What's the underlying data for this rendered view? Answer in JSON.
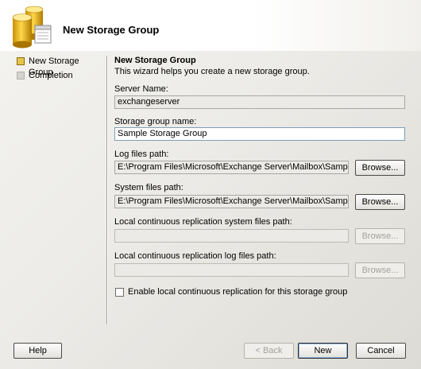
{
  "header": {
    "title": "New Storage Group",
    "icon": "storage-group-icon"
  },
  "nav": {
    "items": [
      {
        "label": "New Storage Group",
        "state": "active"
      },
      {
        "label": "Completion",
        "state": "inactive"
      }
    ]
  },
  "main": {
    "title": "New Storage Group",
    "description": "This wizard helps you create a new storage group.",
    "server_name": {
      "label": "Server Name:",
      "value": "exchangeserver"
    },
    "storage_group_name": {
      "label": "Storage group name:",
      "value": "Sample Storage Group"
    },
    "log_files_path": {
      "label": "Log files path:",
      "value": "E:\\Program Files\\Microsoft\\Exchange Server\\Mailbox\\Sample Storage G",
      "browse_label": "Browse..."
    },
    "system_files_path": {
      "label": "System files path:",
      "value": "E:\\Program Files\\Microsoft\\Exchange Server\\Mailbox\\Sample Storage G",
      "browse_label": "Browse..."
    },
    "lcr_system_files_path": {
      "label": "Local continuous replication system files path:",
      "value": "",
      "browse_label": "Browse..."
    },
    "lcr_log_files_path": {
      "label": "Local continuous replication log files path:",
      "value": "",
      "browse_label": "Browse..."
    },
    "enable_lcr": {
      "label": "Enable local continuous replication for this storage group",
      "checked": false
    }
  },
  "footer": {
    "help_label": "Help",
    "back_label": "< Back",
    "next_label": "New",
    "cancel_label": "Cancel"
  },
  "colors": {
    "active_marker": "#e8c34a",
    "inactive_marker": "#d4d2cd",
    "textbox_border": "#7f9db9"
  }
}
